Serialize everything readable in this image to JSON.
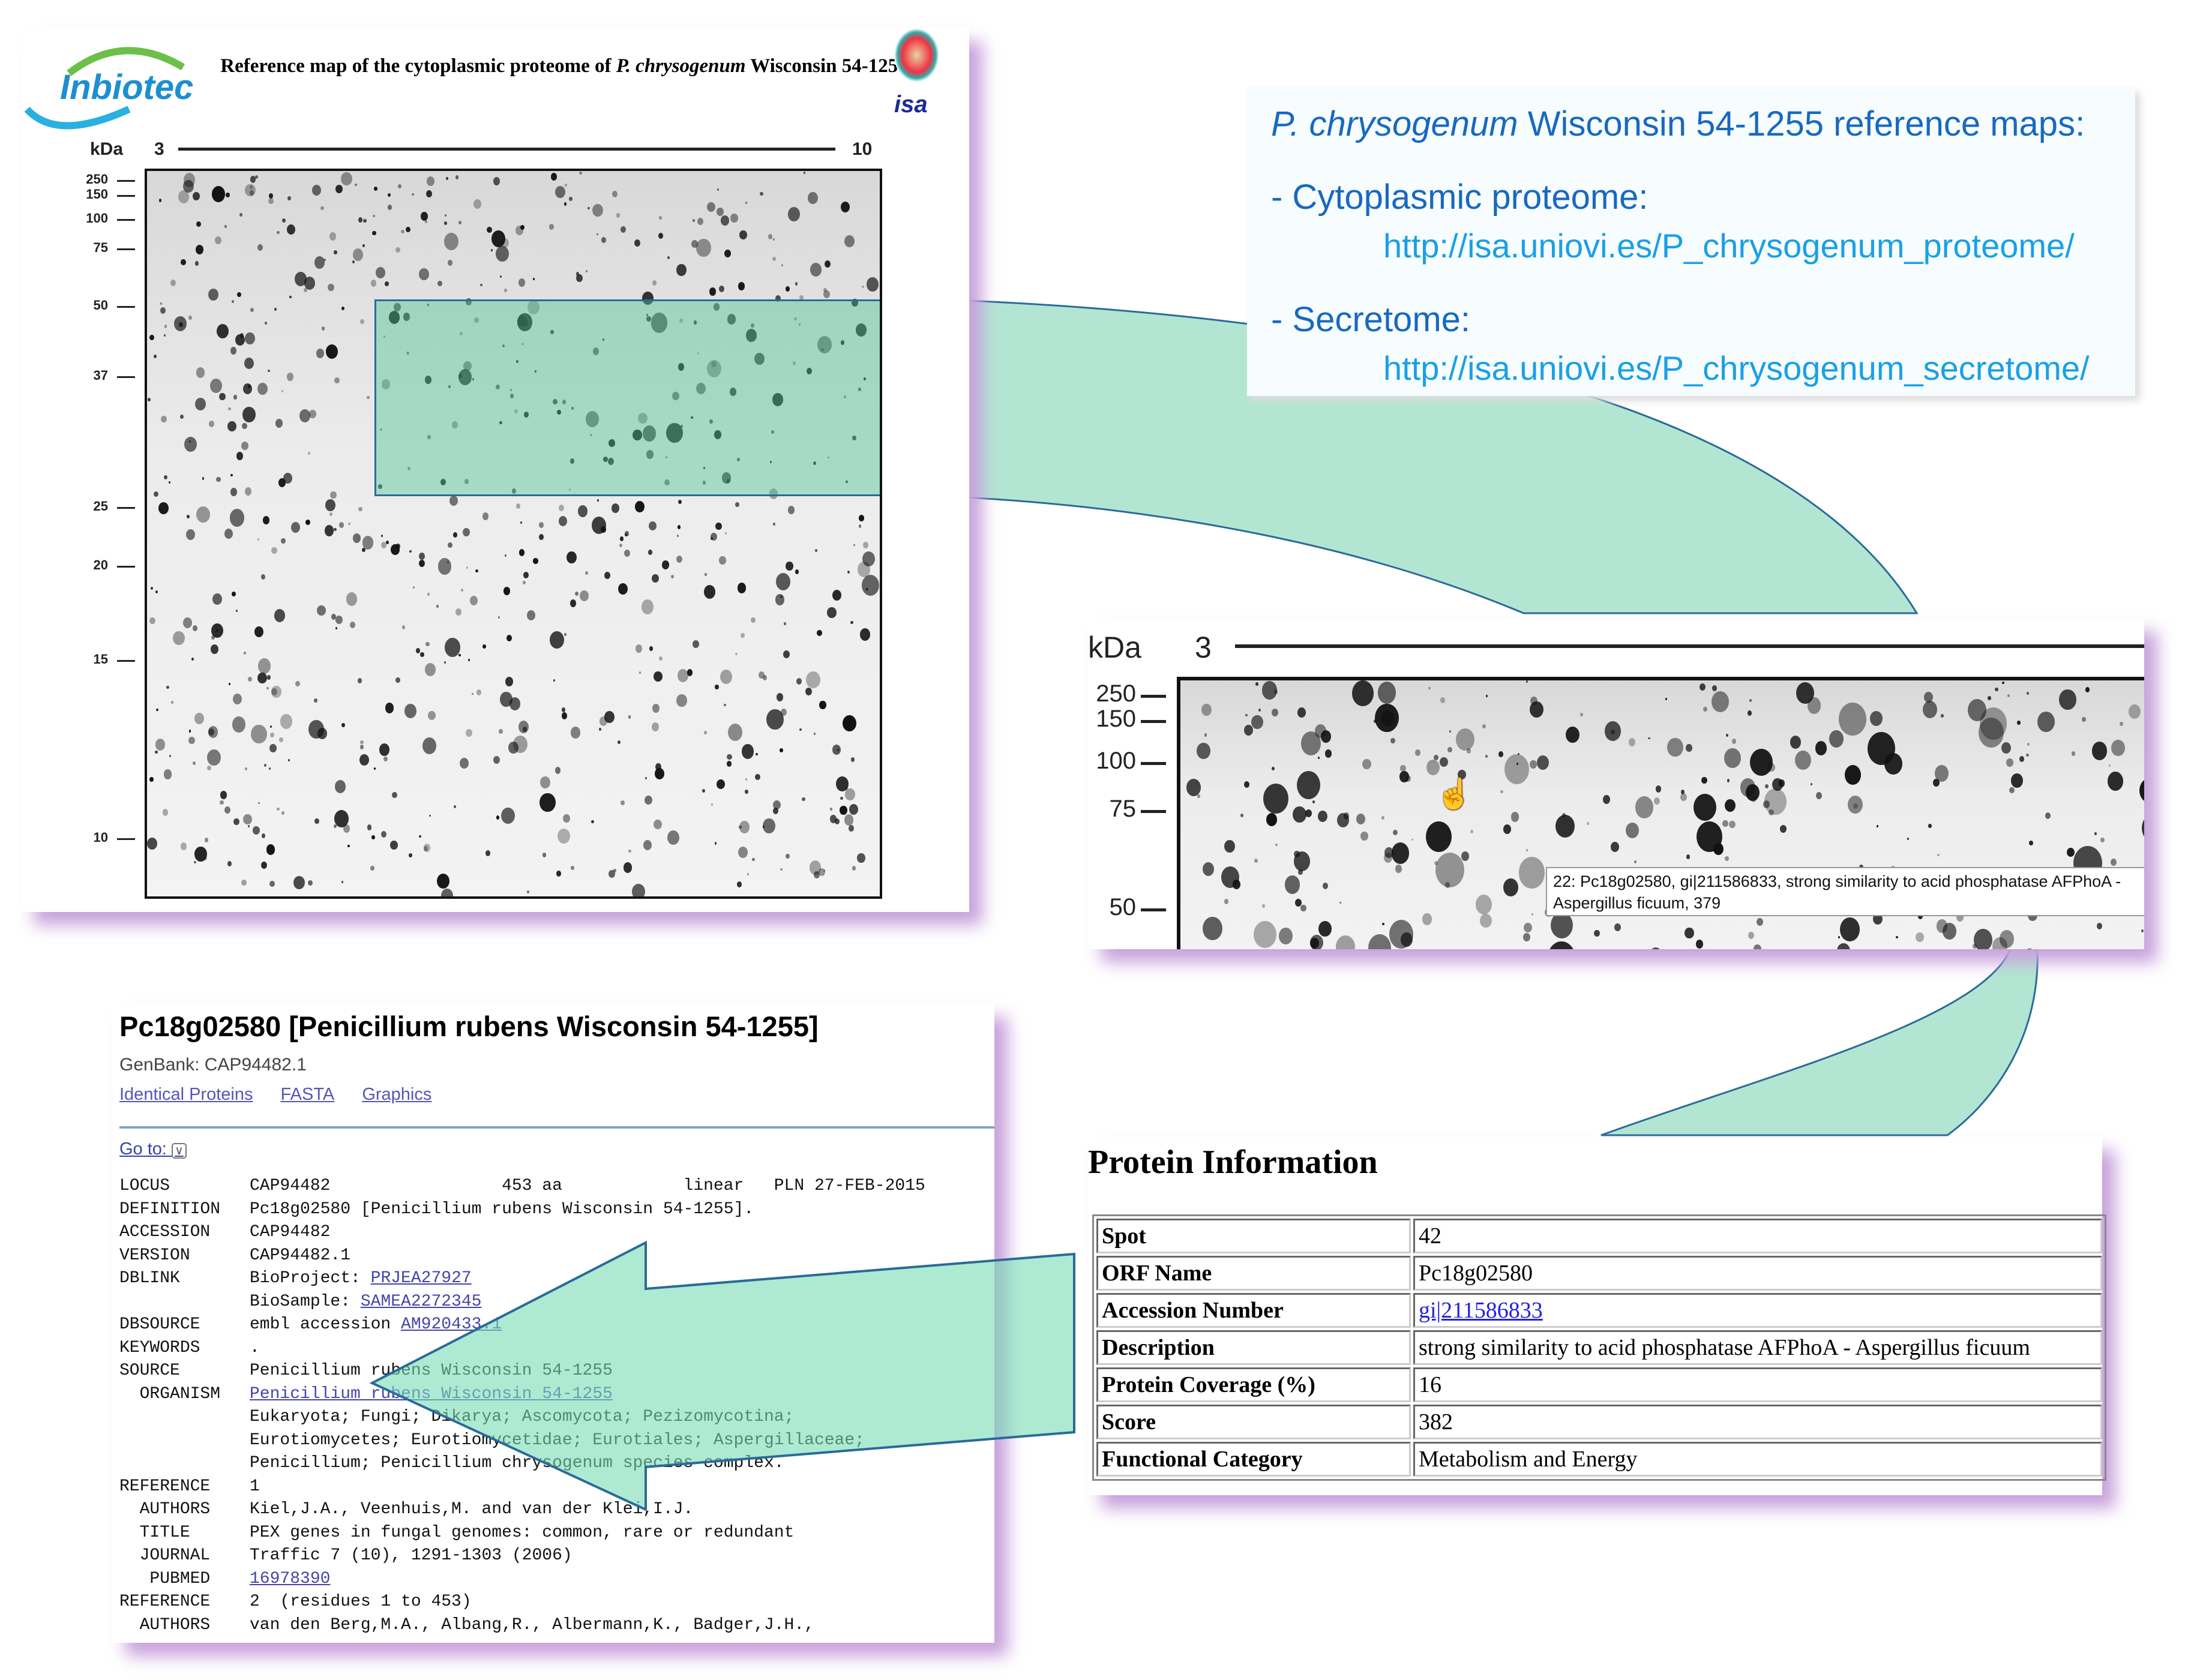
{
  "reference_map": {
    "logo": "Inbiotec",
    "title_part1": "Reference map of the cytoplasmic proteome of ",
    "title_species": "P. chrysogenum",
    "title_part2": " Wisconsin 54-1255",
    "kda": "kDa",
    "ph_start": "3",
    "ph_end": "10",
    "markers": [
      "250",
      "150",
      "100",
      "75",
      "50",
      "37",
      "25",
      "20",
      "15",
      "10"
    ],
    "isa_logo": "isa"
  },
  "maps_box": {
    "species": "P. chrysogenum",
    "title_rest": " Wisconsin 54-1255 reference maps:",
    "item1": "- Cytoplasmic proteome:",
    "link1": "http://isa.uniovi.es/P_chrysogenum_proteome/",
    "item2": "- Secretome:",
    "link2": "http://isa.uniovi.es/P_chrysogenum_secretome/"
  },
  "zoom_gel": {
    "kda": "kDa",
    "ph_start": "3",
    "markers": [
      "250",
      "150",
      "100",
      "75",
      "50"
    ],
    "tooltip": "22: Pc18g02580, gi|211586833, strong similarity to acid phosphatase AFPhoA - Aspergillus ficuum, 379"
  },
  "protein_info": {
    "title": "Protein Information",
    "rows": [
      {
        "key": "Spot",
        "value": "42"
      },
      {
        "key": "ORF Name",
        "value": "Pc18g02580"
      },
      {
        "key": "Accession Number",
        "value": "gi|211586833"
      },
      {
        "key": "Description",
        "value": "strong similarity to acid phosphatase AFPhoA - Aspergillus ficuum"
      },
      {
        "key": "Protein Coverage (%)",
        "value": "16"
      },
      {
        "key": "Score",
        "value": "382"
      },
      {
        "key": "Functional Category",
        "value": "Metabolism and Energy"
      }
    ]
  },
  "genbank": {
    "title": "Pc18g02580 [Penicillium rubens Wisconsin 54-1255]",
    "subtitle": "GenBank: CAP94482.1",
    "links": [
      "Identical Proteins",
      "FASTA",
      "Graphics"
    ],
    "goto": "Go to:",
    "record": [
      {
        "label": "LOCUS",
        "value": "CAP94482                 453 aa            linear   PLN 27-FEB-2015"
      },
      {
        "label": "DEFINITION",
        "value": "Pc18g02580 [Penicillium rubens Wisconsin 54-1255]."
      },
      {
        "label": "ACCESSION",
        "value": "CAP94482"
      },
      {
        "label": "VERSION",
        "value": "CAP94482.1"
      },
      {
        "label": "DBLINK",
        "value": "BioProject: ",
        "link": "PRJEA27927"
      },
      {
        "label": "",
        "value": "BioSample: ",
        "link": "SAMEA2272345"
      },
      {
        "label": "DBSOURCE",
        "value": "embl accession ",
        "link": "AM920433.1"
      },
      {
        "label": "KEYWORDS",
        "value": "."
      },
      {
        "label": "SOURCE",
        "value": "Penicillium rubens Wisconsin 54-1255"
      },
      {
        "label": "  ORGANISM",
        "value": "",
        "link": "Penicillium rubens Wisconsin 54-1255"
      },
      {
        "label": "",
        "value": "Eukaryota; Fungi; Dikarya; Ascomycota; Pezizomycotina;"
      },
      {
        "label": "",
        "value": "Eurotiomycetes; Eurotiomycetidae; Eurotiales; Aspergillaceae;"
      },
      {
        "label": "",
        "value": "Penicillium; Penicillium chrysogenum species complex."
      },
      {
        "label": "REFERENCE",
        "value": "1"
      },
      {
        "label": "  AUTHORS",
        "value": "Kiel,J.A., Veenhuis,M. and van der Klei,I.J."
      },
      {
        "label": "  TITLE",
        "value": "PEX genes in fungal genomes: common, rare or redundant"
      },
      {
        "label": "  JOURNAL",
        "value": "Traffic 7 (10), 1291-1303 (2006)"
      },
      {
        "label": "   PUBMED",
        "value": "",
        "link": "16978390"
      },
      {
        "label": "REFERENCE",
        "value": "2  (residues 1 to 453)"
      },
      {
        "label": "  AUTHORS",
        "value": "van den Berg,M.A., Albang,R., Albermann,K., Badger,J.H.,"
      }
    ]
  },
  "colors": {
    "highlight": "#7fdcb8",
    "shadow": "#c8a2dc",
    "title_blue": "#1769c0",
    "link_cyan": "#19a0e6"
  }
}
